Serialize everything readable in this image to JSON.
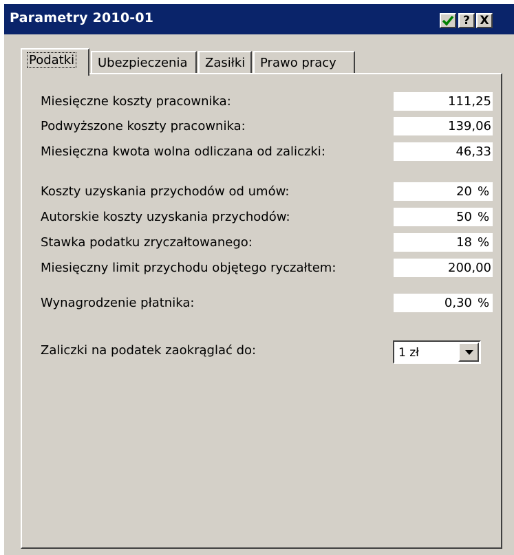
{
  "window": {
    "title": "Parametry 2010-01",
    "buttons": {
      "ok": "✓",
      "help": "?",
      "close": "X"
    }
  },
  "tabs": [
    {
      "label": "Podatki"
    },
    {
      "label": "Ubezpieczenia"
    },
    {
      "label": "Zasiłki"
    },
    {
      "label": "Prawo pracy"
    }
  ],
  "fields": [
    {
      "label": "Miesięczne koszty pracownika:",
      "value": "111,25"
    },
    {
      "label": "Podwyższone koszty pracownika:",
      "value": "139,06"
    },
    {
      "label": "Miesięczna kwota wolna odliczana od zaliczki:",
      "value": "46,33"
    },
    {
      "label": "Koszty uzyskania przychodów od umów:",
      "value": "20"
    },
    {
      "label": "Autorskie koszty uzyskania przychodów:",
      "value": "50"
    },
    {
      "label": "Stawka podatku zryczałtowanego:",
      "value": "18"
    },
    {
      "label": "Miesięczny limit przychodu objętego ryczałtem:",
      "value": "200,00"
    },
    {
      "label": "Wynagrodzenie płatnika:",
      "value": "0,30"
    }
  ],
  "percent_sign": "%",
  "rounding": {
    "label": "Zaliczki na podatek zaokrąglać do:",
    "selected": "1 zł"
  },
  "colors": {
    "titlebar": "#0a246a",
    "face": "#d4d0c8",
    "check": "#008000"
  }
}
